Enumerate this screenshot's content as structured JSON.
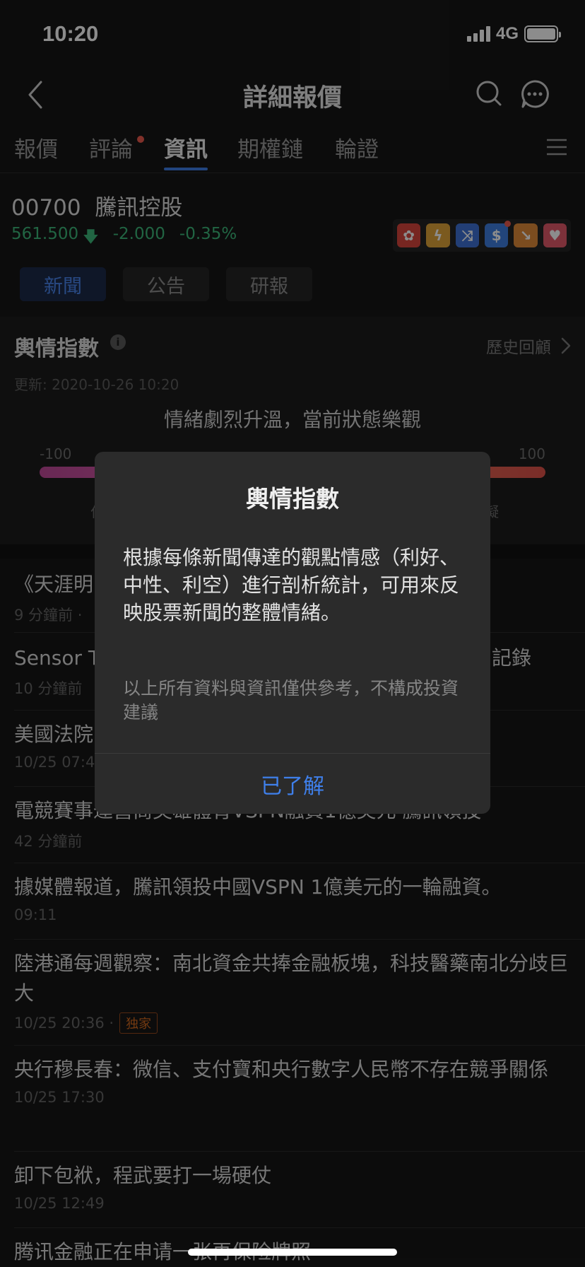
{
  "status_bar": {
    "time": "10:20",
    "network": "4G"
  },
  "nav": {
    "title": "詳細報價",
    "icons": [
      "chevron-left-icon",
      "search-icon",
      "chat-icon"
    ]
  },
  "tabs": [
    {
      "label": "報價",
      "active": false
    },
    {
      "label": "評論",
      "active": false,
      "has_dot": true
    },
    {
      "label": "資訊",
      "active": true
    },
    {
      "label": "期權鏈",
      "active": false
    },
    {
      "label": "輪證",
      "active": false
    }
  ],
  "stock": {
    "code": "00700",
    "name": "騰訊控股",
    "price": "561.500",
    "change": "-2.000",
    "change_pct": "-0.35%",
    "badges": [
      "hk-flag-icon",
      "lightning-icon",
      "shuffle-icon",
      "dollar-icon",
      "trend-icon",
      "heart-icon"
    ]
  },
  "subtabs": [
    {
      "label": "新聞",
      "active": true
    },
    {
      "label": "公告",
      "active": false
    },
    {
      "label": "研報",
      "active": false
    }
  ],
  "sentiment": {
    "title": "輿情指數",
    "history_link": "歷史回顧",
    "updated": "更新: 2020-10-26 10:20",
    "status": "情緒劇烈升溫，當前狀態樂觀",
    "scale_min": "-100",
    "scale_max": "100",
    "left_label_partial": "仁",
    "right_label_partial": "凝"
  },
  "news": [
    {
      "title": "《天涯明",
      "meta": "9 分鐘前 ·"
    },
    {
      "title": "Sensor T",
      "title_tail": "記錄",
      "meta": "10 分鐘前"
    },
    {
      "title": "美國法院",
      "meta": "10/25 07:4"
    },
    {
      "title": "電競賽事運營商英雄體育VSPN融資1億美元 騰訊領投",
      "meta": "42 分鐘前"
    },
    {
      "title": "據媒體報道，騰訊領投中國VSPN 1億美元的一輪融資。",
      "meta": "09:11"
    },
    {
      "title": "陸港通每週觀察：南北資金共捧金融板塊，科技醫藥南北分歧巨大",
      "meta": "10/25 20:36 ·",
      "tag": "独家"
    },
    {
      "title": "央行穆長春：微信、支付寶和央行數字人民幣不存在競爭關係",
      "meta": "10/25 17:30"
    },
    {
      "title": "卸下包袱，程武要打一場硬仗",
      "meta": "10/25 12:49"
    },
    {
      "title": "腾讯金融正在申请一张再保险牌照",
      "meta": ""
    }
  ],
  "dialog": {
    "title": "輿情指數",
    "body": "根據每條新聞傳達的觀點情感（利好、中性、利空）進行剖析統計，可用來反映股票新聞的整體情緒。",
    "note": "以上所有資料與資訊僅供參考，不構成投資建議",
    "button": "已了解"
  },
  "colors": {
    "accent": "#3f80ec",
    "down": "#3db97a",
    "badge_dot": "#ec5a4d"
  }
}
